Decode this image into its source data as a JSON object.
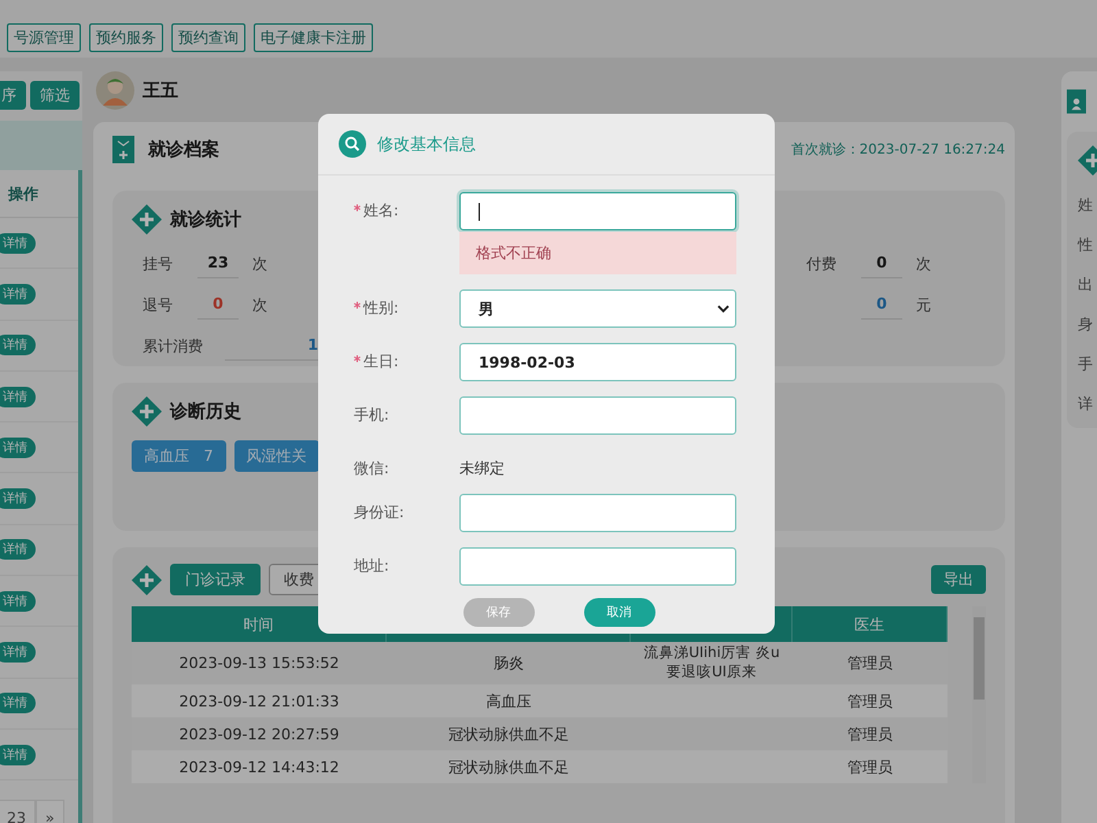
{
  "nav_tabs": [
    {
      "label": "号源管理"
    },
    {
      "label": "预约服务"
    },
    {
      "label": "预约查询"
    },
    {
      "label": "电子健康卡注册"
    }
  ],
  "sidebar": {
    "buttons": [
      "序",
      "筛选"
    ],
    "table_header": "操作",
    "row_actions": [
      "详情",
      "详情",
      "详情",
      "详情",
      "详情",
      "详情",
      "详情",
      "详情",
      "详情",
      "详情",
      "详情"
    ],
    "pagination": [
      "23",
      "»"
    ]
  },
  "patient": {
    "name": "王五"
  },
  "record_card": {
    "title": "就诊档案",
    "first_visit": "首次就诊：2023-07-27 16:27:24"
  },
  "stats": {
    "title": "就诊统计",
    "left_items": [
      {
        "label": "挂号",
        "value": "23",
        "unit": "次",
        "kind": "count"
      },
      {
        "label": "退号",
        "value": "0",
        "unit": "次",
        "kind": "refund"
      },
      {
        "label": "累计消费",
        "value": "1",
        "kind": "money"
      }
    ],
    "right_items": [
      {
        "label": "付费",
        "value": "0",
        "unit": "次",
        "kind": "count"
      },
      {
        "value": "0",
        "unit": "元",
        "kind": "money"
      }
    ]
  },
  "diagnosis": {
    "title": "诊断历史",
    "tags": [
      {
        "label": "高血压",
        "count": "7"
      },
      {
        "label": "风湿性关"
      }
    ]
  },
  "records": {
    "tabs": [
      {
        "label": "门诊记录",
        "selected": true
      },
      {
        "label": "收费",
        "selected": false
      }
    ],
    "export": "导出",
    "time_header": "时间",
    "doctor_header": "医生",
    "rows": [
      {
        "time": "2023-09-13 15:53:52",
        "column_2": "肠炎",
        "column_3": "流鼻涕UIihi厉害 炎u要退咳UI原来",
        "doctor": "管理员"
      },
      {
        "time": "2023-09-12 21:01:33",
        "column_2": "高血压",
        "doctor": "管理员"
      },
      {
        "time": "2023-09-12 20:27:59",
        "column_2": "冠状动脉供血不足",
        "doctor": "管理员"
      },
      {
        "time": "2023-09-12 14:43:12",
        "column_2": "冠状动脉供血不足",
        "doctor": "管理员"
      }
    ]
  },
  "right_panel": {
    "labels": [
      "姓",
      "性",
      "出",
      "身",
      "手",
      "详"
    ]
  },
  "dialog": {
    "title": "修改基本信息",
    "fields": [
      {
        "label": "姓名:",
        "required": true,
        "kind": "input",
        "focused": true,
        "error": "格式不正确"
      },
      {
        "label": "性别:",
        "required": true,
        "kind": "select",
        "value": "男"
      },
      {
        "label": "生日:",
        "required": true,
        "kind": "input",
        "focused": false,
        "value": "1998-02-03"
      },
      {
        "label": "手机:",
        "required": false,
        "kind": "input",
        "focused": false
      },
      {
        "label": "微信:",
        "required": false,
        "kind": "text",
        "value": "未绑定"
      },
      {
        "label": "身份证:",
        "required": false,
        "kind": "input",
        "focused": false
      },
      {
        "label": "地址:",
        "required": false,
        "kind": "input",
        "focused": false
      }
    ],
    "buttons": [
      {
        "label": "保存",
        "disabled": true
      },
      {
        "label": "取消",
        "disabled": false
      }
    ]
  }
}
